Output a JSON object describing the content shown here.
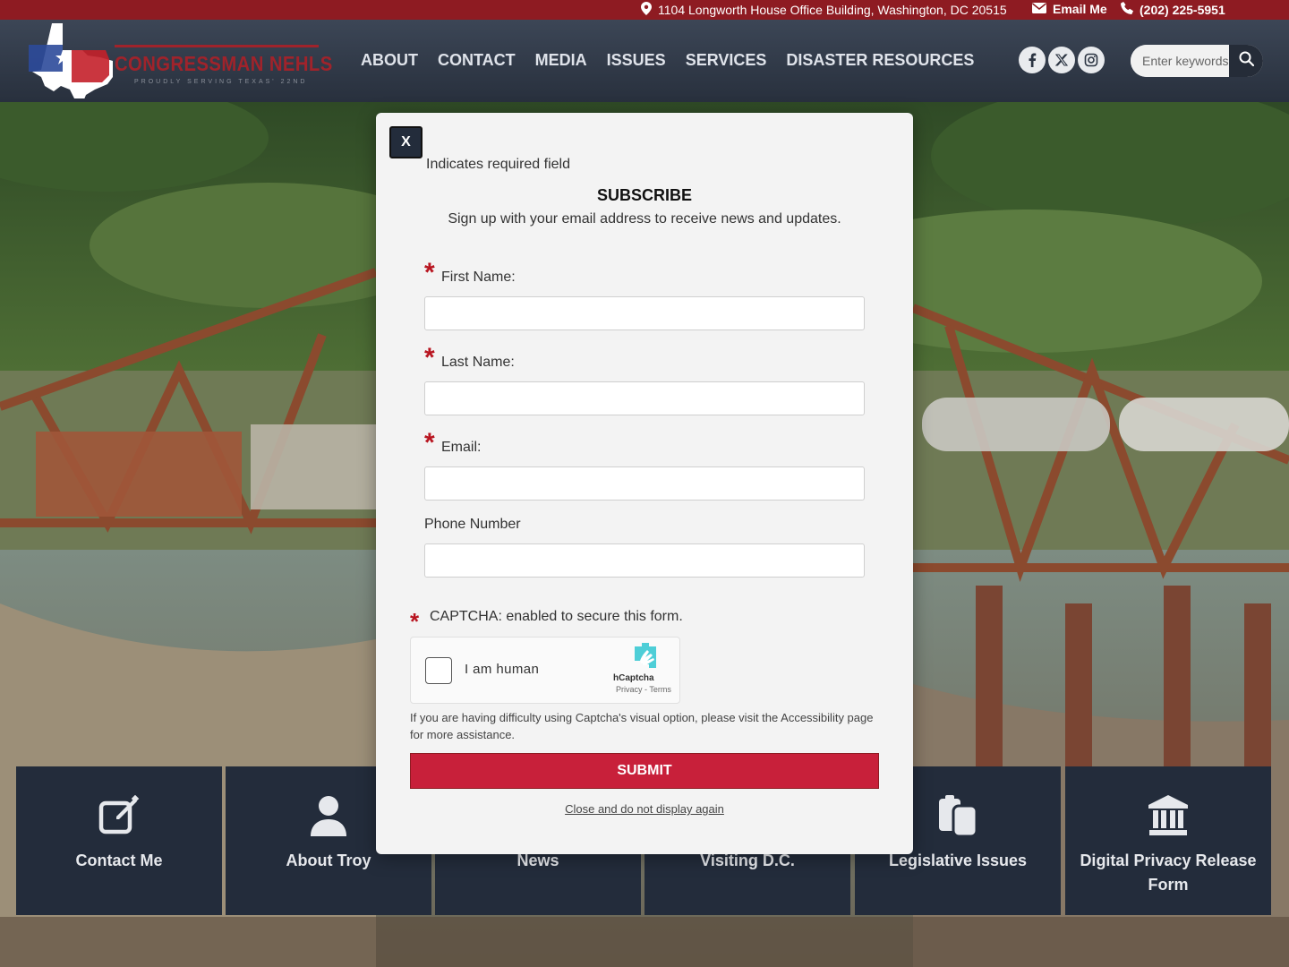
{
  "topbar": {
    "address": "1104 Longworth House Office Building, Washington, DC 20515",
    "email_label": "Email Me",
    "phone": "(202) 225-5951"
  },
  "header": {
    "logo_text": "CONGRESSMAN NEHLS",
    "logo_subtext": "PROUDLY SERVING TEXAS' 22ND",
    "nav": [
      "ABOUT",
      "CONTACT",
      "MEDIA",
      "ISSUES",
      "SERVICES",
      "DISASTER RESOURCES"
    ],
    "social": [
      "facebook-icon",
      "x-icon",
      "instagram-icon"
    ],
    "search_placeholder": "Enter keywords"
  },
  "tiles": [
    {
      "label": "Contact Me",
      "icon": "edit-icon"
    },
    {
      "label": "About Troy",
      "icon": "person-icon"
    },
    {
      "label": "News",
      "icon": "newspaper-icon"
    },
    {
      "label": "Visiting D.C.",
      "icon": "capitol-icon"
    },
    {
      "label": "Legislative Issues",
      "icon": "clipboard-icon"
    },
    {
      "label": "Digital Privacy Release Form",
      "icon": "bank-icon"
    }
  ],
  "modal": {
    "close_label": "X",
    "required_note": "Indicates required field",
    "title": "SUBSCRIBE",
    "description": "Sign up with your email address to receive news and updates.",
    "fields": {
      "first_name": {
        "label": "First Name:",
        "value": ""
      },
      "last_name": {
        "label": "Last Name:",
        "value": ""
      },
      "email": {
        "label": "Email:",
        "value": ""
      },
      "phone": {
        "label": "Phone Number",
        "value": ""
      }
    },
    "captcha_label": "CAPTCHA: enabled to secure this form.",
    "captcha_checkbox_label": "I am human",
    "captcha_brand": "hCaptcha",
    "captcha_links": "Privacy - Terms",
    "captcha_help": "If you are having difficulty using Captcha's visual option, please visit the Accessibility page for more assistance.",
    "submit_label": "SUBMIT",
    "dismiss_label": "Close and do not display again"
  },
  "colors": {
    "topbar_red": "#8e1b22",
    "navy": "#232c3b",
    "submit_red": "#c8203a",
    "required_star": "#b8141f"
  }
}
